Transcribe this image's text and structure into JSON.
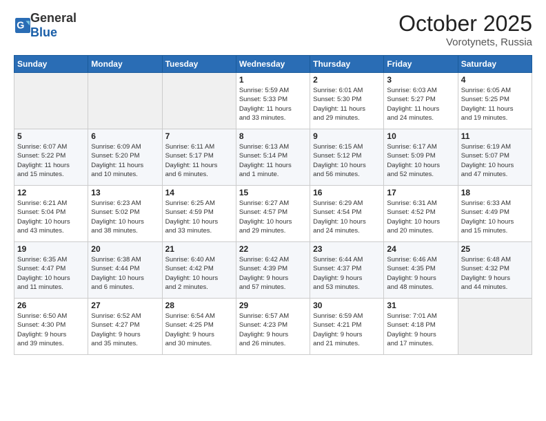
{
  "header": {
    "logo_general": "General",
    "logo_blue": "Blue",
    "month": "October 2025",
    "location": "Vorotynets, Russia"
  },
  "weekdays": [
    "Sunday",
    "Monday",
    "Tuesday",
    "Wednesday",
    "Thursday",
    "Friday",
    "Saturday"
  ],
  "weeks": [
    [
      {
        "day": "",
        "info": ""
      },
      {
        "day": "",
        "info": ""
      },
      {
        "day": "",
        "info": ""
      },
      {
        "day": "1",
        "info": "Sunrise: 5:59 AM\nSunset: 5:33 PM\nDaylight: 11 hours\nand 33 minutes."
      },
      {
        "day": "2",
        "info": "Sunrise: 6:01 AM\nSunset: 5:30 PM\nDaylight: 11 hours\nand 29 minutes."
      },
      {
        "day": "3",
        "info": "Sunrise: 6:03 AM\nSunset: 5:27 PM\nDaylight: 11 hours\nand 24 minutes."
      },
      {
        "day": "4",
        "info": "Sunrise: 6:05 AM\nSunset: 5:25 PM\nDaylight: 11 hours\nand 19 minutes."
      }
    ],
    [
      {
        "day": "5",
        "info": "Sunrise: 6:07 AM\nSunset: 5:22 PM\nDaylight: 11 hours\nand 15 minutes."
      },
      {
        "day": "6",
        "info": "Sunrise: 6:09 AM\nSunset: 5:20 PM\nDaylight: 11 hours\nand 10 minutes."
      },
      {
        "day": "7",
        "info": "Sunrise: 6:11 AM\nSunset: 5:17 PM\nDaylight: 11 hours\nand 6 minutes."
      },
      {
        "day": "8",
        "info": "Sunrise: 6:13 AM\nSunset: 5:14 PM\nDaylight: 11 hours\nand 1 minute."
      },
      {
        "day": "9",
        "info": "Sunrise: 6:15 AM\nSunset: 5:12 PM\nDaylight: 10 hours\nand 56 minutes."
      },
      {
        "day": "10",
        "info": "Sunrise: 6:17 AM\nSunset: 5:09 PM\nDaylight: 10 hours\nand 52 minutes."
      },
      {
        "day": "11",
        "info": "Sunrise: 6:19 AM\nSunset: 5:07 PM\nDaylight: 10 hours\nand 47 minutes."
      }
    ],
    [
      {
        "day": "12",
        "info": "Sunrise: 6:21 AM\nSunset: 5:04 PM\nDaylight: 10 hours\nand 43 minutes."
      },
      {
        "day": "13",
        "info": "Sunrise: 6:23 AM\nSunset: 5:02 PM\nDaylight: 10 hours\nand 38 minutes."
      },
      {
        "day": "14",
        "info": "Sunrise: 6:25 AM\nSunset: 4:59 PM\nDaylight: 10 hours\nand 33 minutes."
      },
      {
        "day": "15",
        "info": "Sunrise: 6:27 AM\nSunset: 4:57 PM\nDaylight: 10 hours\nand 29 minutes."
      },
      {
        "day": "16",
        "info": "Sunrise: 6:29 AM\nSunset: 4:54 PM\nDaylight: 10 hours\nand 24 minutes."
      },
      {
        "day": "17",
        "info": "Sunrise: 6:31 AM\nSunset: 4:52 PM\nDaylight: 10 hours\nand 20 minutes."
      },
      {
        "day": "18",
        "info": "Sunrise: 6:33 AM\nSunset: 4:49 PM\nDaylight: 10 hours\nand 15 minutes."
      }
    ],
    [
      {
        "day": "19",
        "info": "Sunrise: 6:35 AM\nSunset: 4:47 PM\nDaylight: 10 hours\nand 11 minutes."
      },
      {
        "day": "20",
        "info": "Sunrise: 6:38 AM\nSunset: 4:44 PM\nDaylight: 10 hours\nand 6 minutes."
      },
      {
        "day": "21",
        "info": "Sunrise: 6:40 AM\nSunset: 4:42 PM\nDaylight: 10 hours\nand 2 minutes."
      },
      {
        "day": "22",
        "info": "Sunrise: 6:42 AM\nSunset: 4:39 PM\nDaylight: 9 hours\nand 57 minutes."
      },
      {
        "day": "23",
        "info": "Sunrise: 6:44 AM\nSunset: 4:37 PM\nDaylight: 9 hours\nand 53 minutes."
      },
      {
        "day": "24",
        "info": "Sunrise: 6:46 AM\nSunset: 4:35 PM\nDaylight: 9 hours\nand 48 minutes."
      },
      {
        "day": "25",
        "info": "Sunrise: 6:48 AM\nSunset: 4:32 PM\nDaylight: 9 hours\nand 44 minutes."
      }
    ],
    [
      {
        "day": "26",
        "info": "Sunrise: 6:50 AM\nSunset: 4:30 PM\nDaylight: 9 hours\nand 39 minutes."
      },
      {
        "day": "27",
        "info": "Sunrise: 6:52 AM\nSunset: 4:27 PM\nDaylight: 9 hours\nand 35 minutes."
      },
      {
        "day": "28",
        "info": "Sunrise: 6:54 AM\nSunset: 4:25 PM\nDaylight: 9 hours\nand 30 minutes."
      },
      {
        "day": "29",
        "info": "Sunrise: 6:57 AM\nSunset: 4:23 PM\nDaylight: 9 hours\nand 26 minutes."
      },
      {
        "day": "30",
        "info": "Sunrise: 6:59 AM\nSunset: 4:21 PM\nDaylight: 9 hours\nand 21 minutes."
      },
      {
        "day": "31",
        "info": "Sunrise: 7:01 AM\nSunset: 4:18 PM\nDaylight: 9 hours\nand 17 minutes."
      },
      {
        "day": "",
        "info": ""
      }
    ]
  ]
}
